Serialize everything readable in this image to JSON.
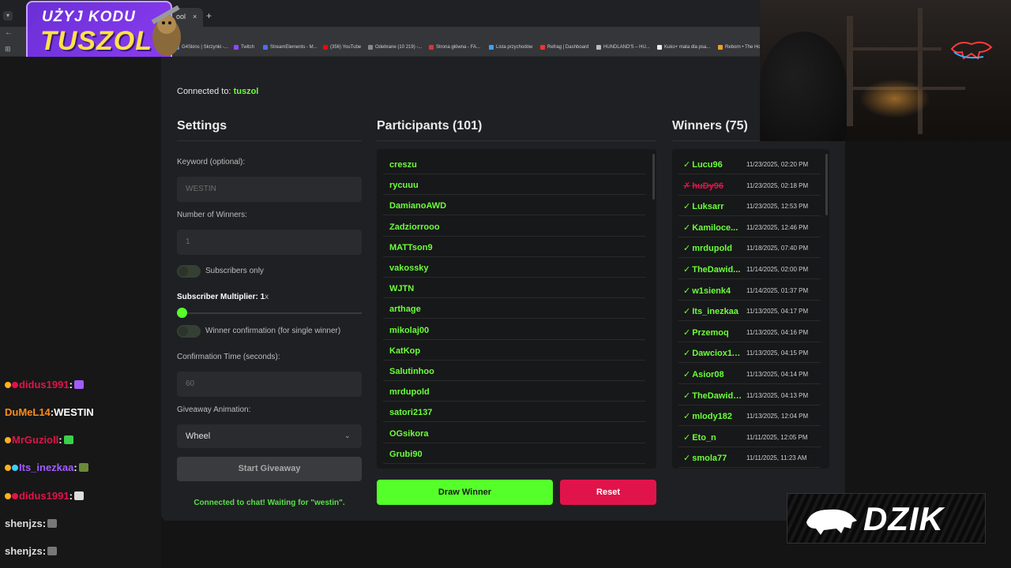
{
  "browser": {
    "tab_title": "ool",
    "tab_close": "×",
    "new_tab": "+",
    "bookmarks": [
      {
        "label": "G4Skins | Skrzynki -...",
        "color": "#3aa0ff"
      },
      {
        "label": "Twitch",
        "color": "#9146ff"
      },
      {
        "label": "StreamElements - M...",
        "color": "#4a6cff"
      },
      {
        "label": "(356) YouTube",
        "color": "#ff0000"
      },
      {
        "label": "Odebrane (10 219) -...",
        "color": "#888888"
      },
      {
        "label": "Strona główna - FA...",
        "color": "#d33"
      },
      {
        "label": "Lista przychodów",
        "color": "#3aa0ff"
      },
      {
        "label": "Refrag | Dashboard",
        "color": "#e33"
      },
      {
        "label": "HUNDLAND'S – HU...",
        "color": "#bbbbbb"
      },
      {
        "label": "Kuko+ mata dla psa...",
        "color": "#eeeeee"
      },
      {
        "label": "Reborn • The Ho",
        "color": "#f0a020"
      }
    ]
  },
  "logo": {
    "line1": "UŻYJ KODU",
    "line2": "TUSZOL"
  },
  "app": {
    "connected_prefix": "Connected to: ",
    "connected_channel": "tuszol",
    "settings": {
      "title": "Settings",
      "keyword_label": "Keyword (optional):",
      "keyword_placeholder": "WESTIN",
      "winners_label": "Number of Winners:",
      "winners_value": "1",
      "subscribers_only": "Subscribers only",
      "multiplier_label": "Subscriber Multiplier: 1",
      "multiplier_suffix": "x",
      "multiplier_value": 1,
      "winner_confirmation": "Winner confirmation (for single winner)",
      "confirmation_label": "Confirmation Time (seconds):",
      "confirmation_value": "60",
      "animation_label": "Giveaway Animation:",
      "animation_value": "Wheel",
      "start_button": "Start Giveaway",
      "status": "Connected to chat! Waiting for \"westin\"."
    },
    "participants": {
      "title": "Participants (101)",
      "items": [
        "creszu",
        "rycuuu",
        "DamianoAWD",
        "Zadziorrooo",
        "MATTson9",
        "vakossky",
        "WJTN",
        "arthage",
        "mikolaj00",
        "KatKop",
        "Salutinhoo",
        "mrdupold",
        "satori2137",
        "OGsikora",
        "Grubi90"
      ]
    },
    "draw_button": "Draw Winner",
    "reset_button": "Reset",
    "winners": {
      "title": "Winners (75)",
      "items": [
        {
          "mark": "✓",
          "name": "Lucu96",
          "date": "11/23/2025, 02:20 PM",
          "rejected": false
        },
        {
          "mark": "✗",
          "name": "huDy96",
          "date": "11/23/2025, 02:18 PM",
          "rejected": true
        },
        {
          "mark": "✓",
          "name": "Luksarr",
          "date": "11/23/2025, 12:53 PM",
          "rejected": false
        },
        {
          "mark": "✓",
          "name": "Kamiloce...",
          "date": "11/23/2025, 12:46 PM",
          "rejected": false
        },
        {
          "mark": "✓",
          "name": "mrdupold",
          "date": "11/18/2025, 07:40 PM",
          "rejected": false
        },
        {
          "mark": "✓",
          "name": "TheDawid...",
          "date": "11/14/2025, 02:00 PM",
          "rejected": false
        },
        {
          "mark": "✓",
          "name": "w1sienk4",
          "date": "11/14/2025, 01:37 PM",
          "rejected": false
        },
        {
          "mark": "✓",
          "name": "Its_inezkaa",
          "date": "11/13/2025, 04:17 PM",
          "rejected": false
        },
        {
          "mark": "✓",
          "name": "Przemoq",
          "date": "11/13/2025, 04:16 PM",
          "rejected": false
        },
        {
          "mark": "✓",
          "name": "Dawciox11...",
          "date": "11/13/2025, 04:15 PM",
          "rejected": false
        },
        {
          "mark": "✓",
          "name": "Asior08",
          "date": "11/13/2025, 04:14 PM",
          "rejected": false
        },
        {
          "mark": "✓",
          "name": "TheDawidek",
          "date": "11/13/2025, 04:13 PM",
          "rejected": false
        },
        {
          "mark": "✓",
          "name": "mlody182",
          "date": "11/13/2025, 12:04 PM",
          "rejected": false
        },
        {
          "mark": "✓",
          "name": "Eto_n",
          "date": "11/11/2025, 12:05 PM",
          "rejected": false
        },
        {
          "mark": "✓",
          "name": "smola77",
          "date": "11/11/2025, 11:23 AM",
          "rejected": false
        }
      ]
    }
  },
  "chat": [
    {
      "user": "didus1991",
      "text": "",
      "user_color": "#e0144a",
      "emote_color": "#a15cff",
      "badges": [
        "#ffb020",
        "#e0144a"
      ]
    },
    {
      "user": "DuMeL14",
      "text": "WESTIN",
      "user_color": "#ff8c1a",
      "emote_color": "",
      "badges": []
    },
    {
      "user": "MrGuzioll",
      "text": "",
      "user_color": "#e0144a",
      "emote_color": "#3ad14a",
      "badges": [
        "#ffb020"
      ]
    },
    {
      "user": "Its_inezkaa",
      "text": "",
      "user_color": "#a15cff",
      "emote_color": "#6a8a3a",
      "badges": [
        "#ffb020",
        "#3ad1ff"
      ]
    },
    {
      "user": "didus1991",
      "text": "",
      "user_color": "#e0144a",
      "emote_color": "#dddddd",
      "badges": [
        "#ffb020",
        "#e0144a"
      ]
    },
    {
      "user": "shenjzs",
      "text": "",
      "user_color": "#dcdcdc",
      "emote_color": "#777777",
      "badges": []
    },
    {
      "user": "shenjzs",
      "text": "",
      "user_color": "#dcdcdc",
      "emote_color": "#777777",
      "badges": []
    }
  ],
  "dzik": {
    "label": "DZIK"
  }
}
